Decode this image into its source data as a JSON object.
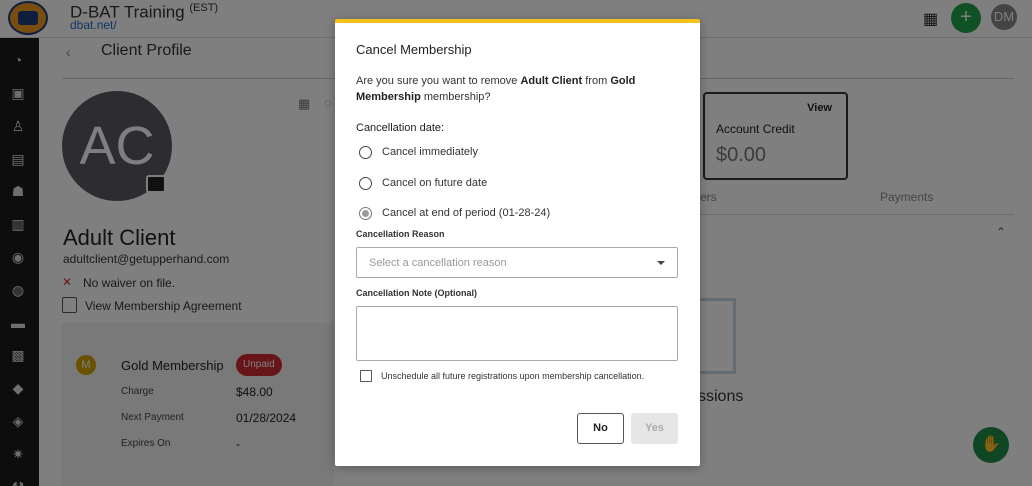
{
  "header": {
    "brand_title": "D-BAT Training",
    "brand_tz": "(EST)",
    "brand_url": "dbat.net/",
    "user_initials": "DM",
    "add_icon": "plus-icon",
    "qr_icon": "qr-code-icon"
  },
  "sidebar": {
    "icons": [
      "dashboard-icon",
      "calendar-icon",
      "shirt-icon",
      "schedule-icon",
      "team-icon",
      "reports-icon",
      "ai-icon",
      "location-icon",
      "tickets-icon",
      "resources-icon",
      "tag-icon",
      "discount-icon",
      "settings-icon",
      "tools-icon"
    ]
  },
  "profile": {
    "title": "Client Profile",
    "initials": "AC",
    "name": "Adult Client",
    "email": "adultclient@getupperhand.com",
    "waiver": "No waiver on file.",
    "agreement_link": "View Membership Agreement"
  },
  "membership_card": {
    "badge": "M",
    "name": "Gold Membership",
    "status": "Unpaid",
    "rows": [
      {
        "label": "Charge",
        "value": "$48.00"
      },
      {
        "label": "Next Payment",
        "value": "01/28/2024"
      },
      {
        "label": "Expires On",
        "value": "-"
      }
    ]
  },
  "account_credit": {
    "view": "View",
    "label": "Account Credit",
    "amount": "$0.00"
  },
  "tabs": {
    "partial": "ers",
    "payments": "Payments"
  },
  "sessions_partial": "ssions",
  "modal": {
    "title": "Cancel Membership",
    "msg_prefix": "Are you sure you want to remove ",
    "client": "Adult Client",
    "msg_mid": " from ",
    "membership": "Gold Membership",
    "msg_suffix": " membership?",
    "date_label": "Cancellation date:",
    "options": [
      {
        "label": "Cancel immediately",
        "checked": false
      },
      {
        "label": "Cancel on future date",
        "checked": false
      },
      {
        "label": "Cancel at end of period (01-28-24)",
        "checked": true
      }
    ],
    "reason_label": "Cancellation Reason",
    "reason_placeholder": "Select a cancellation reason",
    "note_label": "Cancellation Note (Optional)",
    "note_value": "",
    "unschedule_label": "Unschedule all future registrations upon membership cancellation.",
    "unschedule_checked": false,
    "no_label": "No",
    "yes_label": "Yes",
    "accent_color": "#f5c21b"
  }
}
